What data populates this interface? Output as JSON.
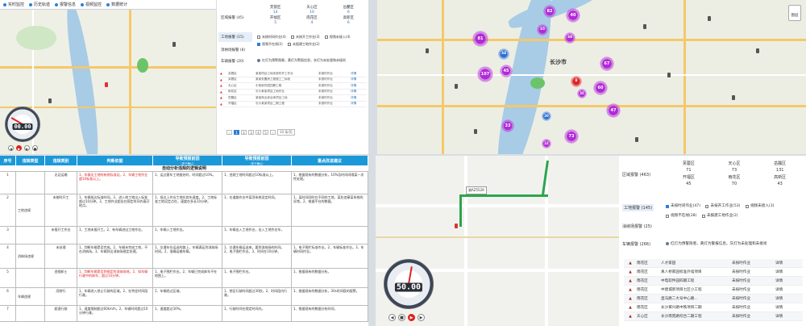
{
  "q1": {
    "toolbar": [
      "实时监控",
      "历史轨迹",
      "报警信息",
      "视频监控",
      "数据统计"
    ],
    "side_tabs": [
      "区域报警 (45)",
      "工地报警 (15)",
      "消纳场报警 (8)",
      "车辆报警 (20)"
    ],
    "region_grid": [
      {
        "name": "芙蓉区",
        "value": "14"
      },
      {
        "name": "天心区",
        "value": "10"
      },
      {
        "name": "岳麓区",
        "value": "6"
      },
      {
        "name": "开福区",
        "value": "5"
      },
      {
        "name": "雨花区",
        "value": "4"
      },
      {
        "name": "高新区",
        "value": "6"
      }
    ],
    "checks": [
      "未按时间作业(4)",
      "未按开工作业(3)",
      "视频未接入(4)",
      "视频不在线(2)",
      "未报建工地作业(2)"
    ],
    "radios": [
      "红灯为预警隐患，黄灯为警报信息，灰灯为未处理和未接尚"
    ],
    "rows": [
      {
        "c1": "芙蓉区",
        "c2": "某某项目工地未按时开工作业",
        "c3": "未按时作业",
        "c4": "详情"
      },
      {
        "c1": "芙蓉区",
        "c2": "某某安置房工程施工二标段",
        "c3": "未按时作业",
        "c4": "详情"
      },
      {
        "c1": "天心区",
        "c2": "中电软件园四期工程",
        "c3": "未按时作业",
        "c4": "详情"
      },
      {
        "c1": "雨花区",
        "c2": "长沙某某项目工地作业",
        "c3": "未按时作业",
        "c4": "详情"
      },
      {
        "c1": "岳麓区",
        "c2": "某某商业综合体项目工地",
        "c3": "未按时作业",
        "c4": "详情"
      },
      {
        "c1": "开福区",
        "c2": "长沙某某项目二期工程",
        "c3": "未按时作业",
        "c4": "详情"
      }
    ],
    "pager": [
      "1",
      "2",
      "3",
      "4",
      "5"
    ],
    "pager_size": "10 条/页",
    "speed": "00.00",
    "speed_unit": "km/h"
  },
  "q2": {
    "city": "长沙市",
    "layers_label": "图层",
    "clusters": [
      {
        "t": "p",
        "label": "82"
      },
      {
        "t": "p",
        "label": "40"
      },
      {
        "t": "p",
        "label": "81"
      },
      {
        "t": "p",
        "label": "35"
      },
      {
        "t": "p",
        "label": "38"
      },
      {
        "t": "b",
        "label": "34"
      },
      {
        "t": "p",
        "label": "67"
      },
      {
        "t": "p",
        "label": "45"
      },
      {
        "t": "p",
        "label": "107"
      },
      {
        "t": "r",
        "label": "8"
      },
      {
        "t": "p",
        "label": "60"
      },
      {
        "t": "p",
        "label": "35"
      },
      {
        "t": "p",
        "label": "47"
      },
      {
        "t": "p",
        "label": "33"
      },
      {
        "t": "p",
        "label": "73"
      },
      {
        "t": "p",
        "label": "20"
      },
      {
        "t": "p",
        "label": "22"
      }
    ]
  },
  "q3": {
    "headers": [
      "序号",
      "违规类型",
      "违规类别",
      "判断依据",
      "导致预报前因",
      "导致预报前因",
      "重点改进建议"
    ],
    "header_notes": [
      "",
      "",
      "",
      "",
      "（多于确认）",
      "（多于确认）",
      ""
    ],
    "subtitle": "自动分析违规的逻辑说明",
    "rows": [
      {
        "no": "1",
        "type": "",
        "cat": "无证运输",
        "basis": "1、车辆无工地的有效标准证。2、车辆工地作业超10标准以上。",
        "cause": "1、运过客车工地查处时，时间超过10%。",
        "cause2": "1、违规工地时间超过10标准以上。",
        "advice": "1、根据现有的数据分析，10%及时间间隔某一次性处理。"
      },
      {
        "no": "2",
        "type": "工地违规",
        "cat": "未按时开工",
        "basis": "1、车辆抵达标准时间。2、进入地工地出入标准超过10分钟。3、工地作业超出在规定时间内离开地点。",
        "cause": "1、抵达上作业工地在其车速度。2、工地标准工地设定点在，速度在多长10分钟。",
        "cause2": "1、在道路作业中某项系统设定时间。",
        "advice": "1、某时间同时在不同的工地，某些违章某系统的异常。2、根据平台的数据。"
      },
      {
        "no": "3",
        "type": "",
        "cat": "未报开工作业",
        "basis": "1、工地未报开工。2、有车辆进出工地作业。",
        "cause": "1、车辆入工地作业。",
        "cause2": "1、车辆出入工地作业，出入工地作业车。",
        "advice": ""
      },
      {
        "no": "4",
        "type": "消纳场违规",
        "cat": "未处理",
        "basis": "1、判断车辆是否完成。2、车辆未完成工地，不在消纳场。3、车辆到达消纳场规定处理。",
        "cause": "1、交通车在运送的路上，车辆满足到消纳场时间。2、准确运输车辆。",
        "cause2": "1、交通车辆运送来，要到消纳场的时间。2、电子围栏作业。3、时间在10分钟。",
        "advice": "1、电子围栏标准作业。2、车辆标准作业。3、车辆时间作业。"
      },
      {
        "no": "5",
        "type": "",
        "cat": "违规卸土",
        "basis": "1、判断车辆是否到指定的消纳场地。2、如车辆行驶中的卸车，超过10分钟。",
        "cause": "1、电子围栏作业。2、车辆已完成卸车不在地图上。",
        "cause2": "1、电子围栏作业。",
        "advice": "1、根据现有的数据分析。"
      },
      {
        "no": "6",
        "type": "车辆违规",
        "cat": "闯禁行",
        "basis": "1、车辆进入禁止行驶的区域。2、在特定时间段行驶。",
        "cause": "1、车辆经过区域。",
        "cause2": "1、禁区行驶时间超过30秒。2、时间段内行驶。",
        "advice": "1、根据现有的数据分析，30s时间段的报警。"
      },
      {
        "no": "7",
        "type": "",
        "cat": "超速行驶",
        "basis": "1、速度限制超过60km/h。2、车辆时间超过10分钟行驶。",
        "cause": "1、速度超过30%。",
        "cause2": "1、行驶时间在规定时间内。",
        "advice": "1、根据现有的数据分析时间。"
      }
    ]
  },
  "q4": {
    "plate": "湘AZ5529",
    "speed": "50.00",
    "speed_unit": "km/h",
    "side_tabs": [
      "区域报警 (463)",
      "工地报警 (145)",
      "消纳场报警 (25)",
      "车辆报警 (266)"
    ],
    "region_grid": [
      {
        "name": "芙蓉区",
        "value": "71"
      },
      {
        "name": "天心区",
        "value": "73"
      },
      {
        "name": "岳麓区",
        "value": "131"
      },
      {
        "name": "开福区",
        "value": "45"
      },
      {
        "name": "雨花区",
        "value": "70"
      },
      {
        "name": "高新区",
        "value": "43"
      }
    ],
    "checks": [
      "未按时间作业(47)",
      "未按开工作业(53)",
      "视频未接入(3)",
      "视频不在线(28)",
      "未报建工地作业(2)"
    ],
    "radio": "红灯为预警隐患，黄灯为警报信息，灰灯为未处理和未接尚",
    "rows": [
      {
        "c1": "雨花区",
        "c2": "人才家园",
        "c3": "未按时作业",
        "c4": "详情"
      },
      {
        "c1": "雨花区",
        "c2": "真人桥家园标准外墙项目",
        "c3": "未按时作业",
        "c4": "详情"
      },
      {
        "c1": "雨花区",
        "c2": "中电软件园四期工程",
        "c3": "未按时作业",
        "c4": "详情"
      },
      {
        "c1": "雨花区",
        "c2": "中建城新项目七区小工程",
        "c3": "未按时作业",
        "c4": "详情"
      },
      {
        "c1": "雨花区",
        "c2": "直马路二大号中心路...",
        "c3": "未按时作业",
        "c4": "详情"
      },
      {
        "c1": "雨花区",
        "c2": "长沙黄兴路中铁项目二期",
        "c3": "未按时作业",
        "c4": "详情"
      },
      {
        "c1": "天心区",
        "c2": "长沙南苑路综合二期工程",
        "c3": "未按时作业",
        "c4": "详情"
      }
    ]
  }
}
